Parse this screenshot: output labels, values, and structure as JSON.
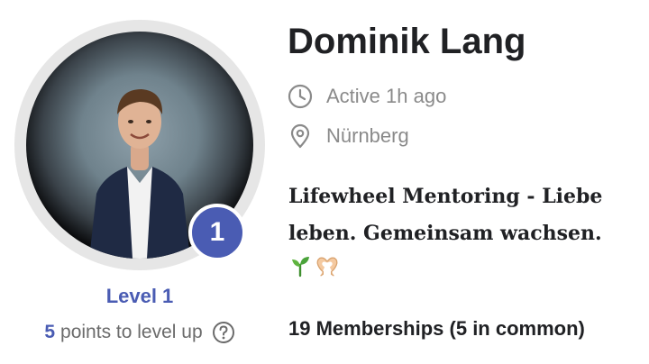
{
  "profile": {
    "name": "Dominik Lang",
    "active": "Active 1h ago",
    "location": "Nürnberg",
    "bio": "Lifewheel Mentoring - Liebe leben. Gemeinsam wachsen.",
    "bio_emojis": [
      "seedling",
      "heart-hands"
    ],
    "memberships": "19 Memberships (5 in common)"
  },
  "level": {
    "number": "1",
    "label": "Level 1",
    "points": "5",
    "points_suffix": "points to level up"
  },
  "colors": {
    "accent": "#4a5cb3",
    "muted": "#8a8a8a",
    "text": "#202124"
  },
  "icons": {
    "active": "clock-icon",
    "location": "location-pin-icon",
    "help": "help-circle-icon"
  }
}
